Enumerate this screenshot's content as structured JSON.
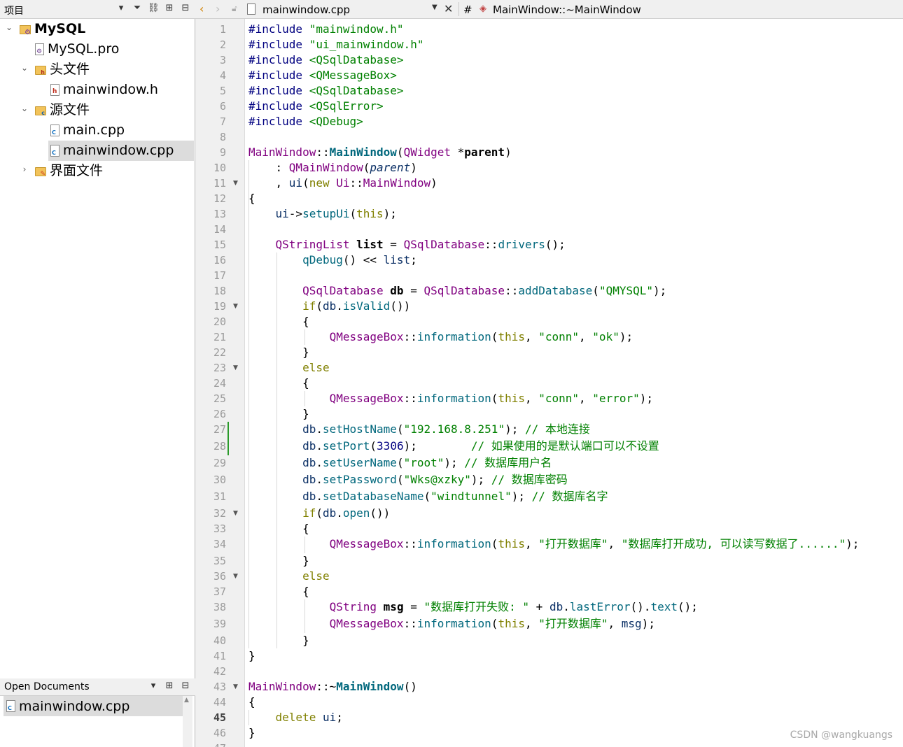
{
  "project_pane": {
    "title": "项目",
    "tree": [
      {
        "label": "MySQL",
        "bold": true,
        "icon": "project-icon",
        "expanded": true,
        "depth": 0
      },
      {
        "label": "MySQL.pro",
        "icon": "pro-file-icon",
        "depth": 1
      },
      {
        "label": "头文件",
        "icon": "header-folder-icon",
        "expanded": true,
        "depth": 1
      },
      {
        "label": "mainwindow.h",
        "icon": "header-file-icon",
        "depth": 2
      },
      {
        "label": "源文件",
        "icon": "source-folder-icon",
        "expanded": true,
        "depth": 1
      },
      {
        "label": "main.cpp",
        "icon": "cpp-file-icon",
        "depth": 2
      },
      {
        "label": "mainwindow.cpp",
        "icon": "cpp-file-icon",
        "depth": 2,
        "selected": true
      },
      {
        "label": "界面文件",
        "icon": "form-folder-icon",
        "expanded": false,
        "depth": 1
      }
    ]
  },
  "open_documents": {
    "title": "Open Documents",
    "items": [
      "mainwindow.cpp"
    ]
  },
  "editor_toolbar": {
    "file_name": "mainwindow.cpp",
    "hash": "#",
    "symbol": "MainWindow::~MainWindow"
  },
  "editor": {
    "current_line": 45,
    "lines": [
      "#include \"mainwindow.h\"",
      "#include \"ui_mainwindow.h\"",
      "#include <QSqlDatabase>",
      "#include <QMessageBox>",
      "#include <QSqlDatabase>",
      "#include <QSqlError>",
      "#include <QDebug>",
      "",
      "MainWindow::MainWindow(QWidget *parent)",
      "    : QMainWindow(parent)",
      "    , ui(new Ui::MainWindow)",
      "{",
      "    ui->setupUi(this);",
      "",
      "    QStringList list = QSqlDatabase::drivers();",
      "        qDebug() << list;",
      "",
      "        QSqlDatabase db = QSqlDatabase::addDatabase(\"QMYSQL\");",
      "        if(db.isValid())",
      "        {",
      "            QMessageBox::information(this, \"conn\", \"ok\");",
      "        }",
      "        else",
      "        {",
      "            QMessageBox::information(this, \"conn\", \"error\");",
      "        }",
      "        db.setHostName(\"192.168.8.251\"); // 本地连接",
      "        db.setPort(3306);        // 如果使用的是默认端口可以不设置",
      "        db.setUserName(\"root\"); // 数据库用户名",
      "        db.setPassword(\"Wks@xzky\"); // 数据库密码",
      "        db.setDatabaseName(\"windtunnel\"); // 数据库名字",
      "        if(db.open())",
      "        {",
      "            QMessageBox::information(this, \"打开数据库\", \"数据库打开成功, 可以读写数据了......\");",
      "        }",
      "        else",
      "        {",
      "            QString msg = \"数据库打开失败: \" + db.lastError().text();",
      "            QMessageBox::information(this, \"打开数据库\", msg);",
      "        }",
      "}",
      "",
      "MainWindow::~MainWindow()",
      "{",
      "    delete ui;",
      "}"
    ]
  },
  "watermark": "CSDN @wangkuangs"
}
